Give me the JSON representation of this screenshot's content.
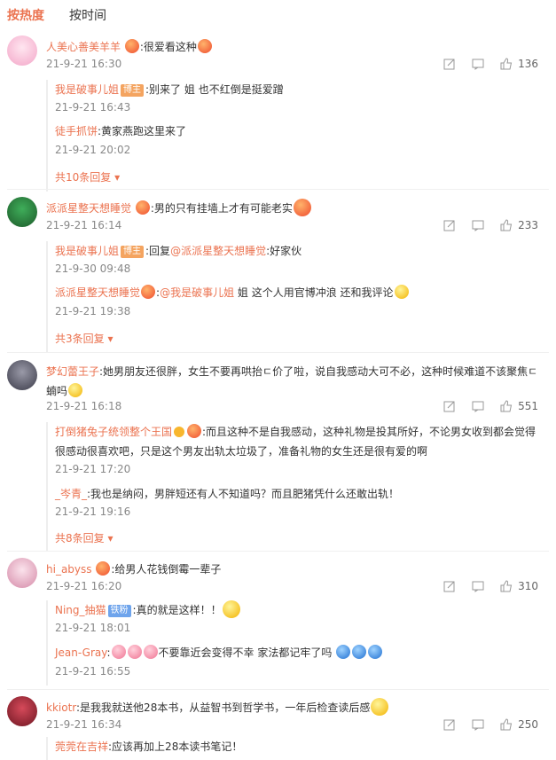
{
  "tabs": {
    "hot": "按热度",
    "time": "按时间"
  },
  "c1": {
    "user": "人美心善美羊羊",
    "text": ":很爱看这种",
    "time": "21-9-21 16:30",
    "likes": "136",
    "r1": {
      "user": "我是破事儿姐",
      "badge": "博主",
      "text": ":别来了 姐 也不红倒是挺爱蹭",
      "time": "21-9-21 16:43"
    },
    "r2": {
      "user": "徒手抓饼",
      "text": ":黄家燕跑这里来了",
      "time": "21-9-21 20:02"
    },
    "more": "共10条回复"
  },
  "c2": {
    "user": "派派星整天想睡觉",
    "text": ":男的只有挂墙上才有可能老实",
    "time": "21-9-21 16:14",
    "likes": "233",
    "r1": {
      "user": "我是破事儿姐",
      "badge": "博主",
      "text_a": ":回复",
      "mention": "@派派星整天想睡觉",
      "text_b": ":好家伙",
      "time": "21-9-30 09:48"
    },
    "r2": {
      "user": "派派星整天想睡觉",
      "text_a": ":",
      "mention": "@我是破事儿姐",
      "text_b": " 姐 这个人用官博冲浪 还和我评论",
      "time": "21-9-21 19:38"
    },
    "more": "共3条回复"
  },
  "c3": {
    "user": "梦幻蕾王子",
    "text": ":她男朋友还很胖，女生不要再哄抬ㄷ价了啦，说自我感动大可不必，这种时候难道不该聚焦ㄷ蝻吗",
    "time": "21-9-21 16:18",
    "likes": "551",
    "r1": {
      "user": "打倒猪兔子统领整个王国",
      "text": ":而且这种不是自我感动，这种礼物是投其所好，不论男女收到都会觉得很感动很喜欢吧，只是这个男友出轨太垃圾了，准备礼物的女生还是很有爱的啊",
      "time": "21-9-21 17:20"
    },
    "r2": {
      "user": "_岑青_",
      "text": ":我也是纳闷，男胖短还有人不知道吗？而且肥猪凭什么还敢出轨！",
      "time": "21-9-21 19:16"
    },
    "more": "共8条回复"
  },
  "c4": {
    "user": "hi_abyss",
    "text": ":给男人花钱倒霉一辈子",
    "time": "21-9-21 16:20",
    "likes": "310",
    "r1": {
      "user": "Ning_抽猫",
      "badge": "铁粉",
      "text": ":真的就是这样！！",
      "time": "21-9-21 18:01"
    },
    "r2": {
      "user": "Jean-Gray",
      "text_a": ":",
      "text_b": "不要靠近会变得不幸 家法都记牢了吗",
      "time": "21-9-21 16:55"
    }
  },
  "c5": {
    "user": "kkiotr",
    "text": ":是我我就送他28本书，从益智书到哲学书，一年后检查读后感",
    "time": "21-9-21 16:34",
    "likes": "250",
    "r1": {
      "user": "莞莞在吉祥",
      "text": ":应该再加上28本读书笔记！"
    }
  }
}
